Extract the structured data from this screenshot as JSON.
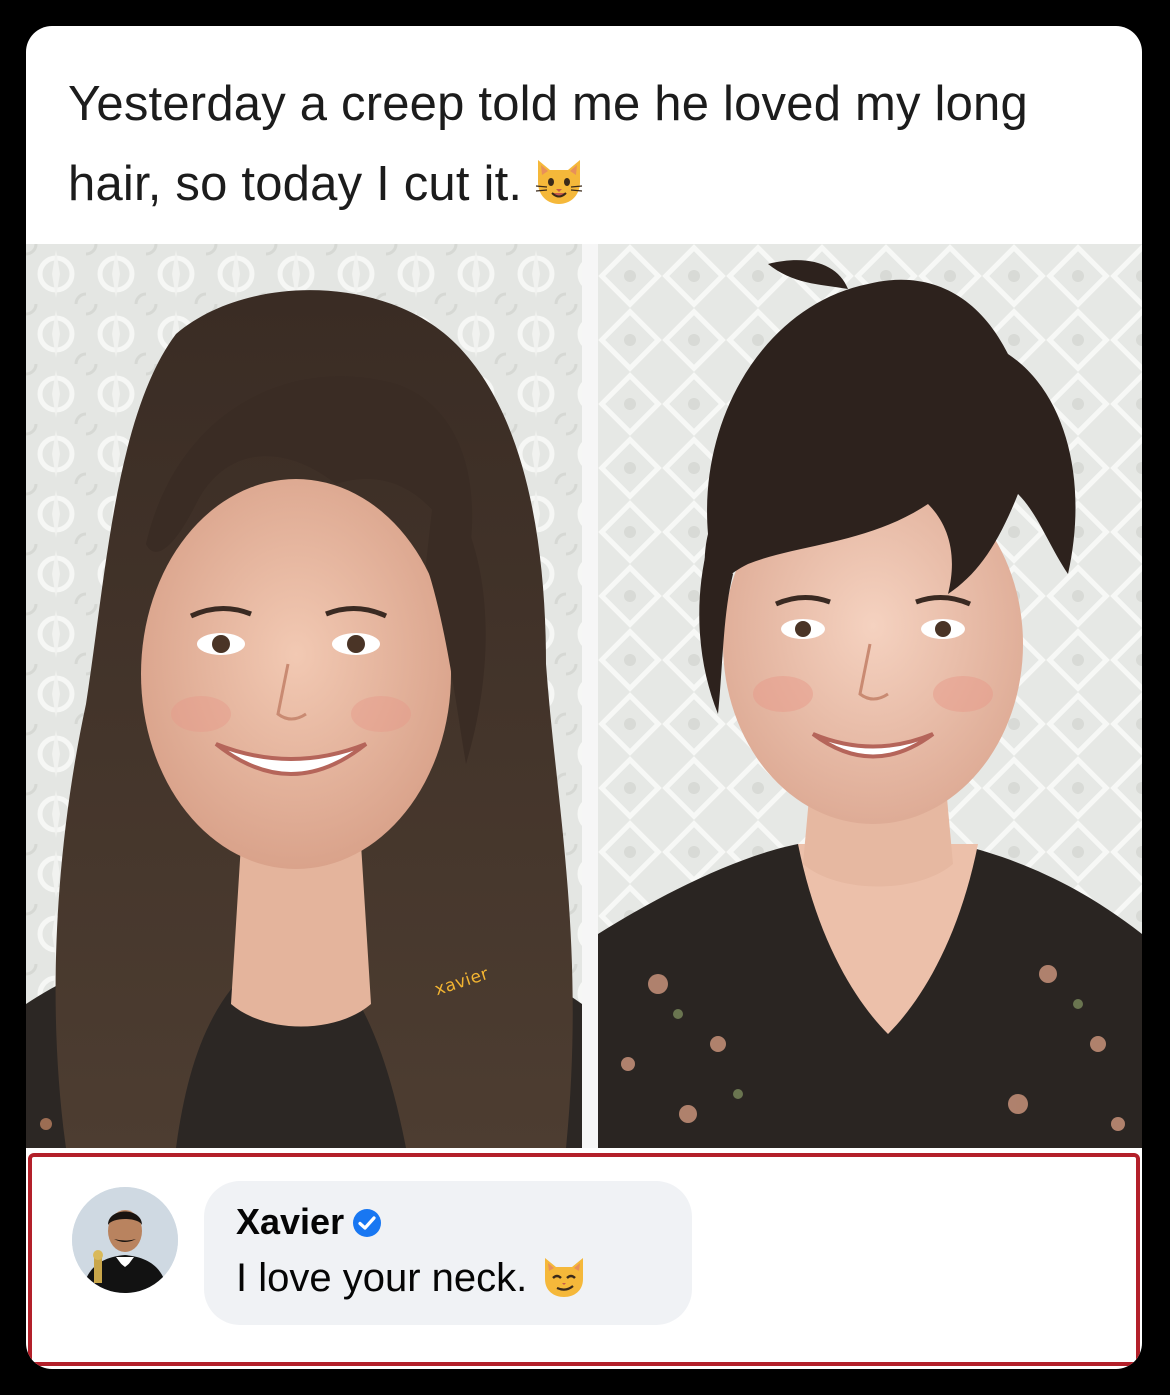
{
  "post": {
    "caption": "Yesterday a creep told me he loved my long hair, so today I cut it.",
    "caption_emoji": "cat-face-icon"
  },
  "photos": {
    "left_alt": "woman-long-hair-photo",
    "right_alt": "woman-short-hair-photo",
    "watermark": "xavier"
  },
  "comment": {
    "author": "Xavier",
    "verified": true,
    "text": "I love your neck.",
    "emoji": "smirking-cat-icon"
  },
  "colors": {
    "background": "#000000",
    "card": "#ffffff",
    "highlight_border": "#b3202a",
    "bubble": "#f0f2f5",
    "verified": "#1877f2"
  }
}
